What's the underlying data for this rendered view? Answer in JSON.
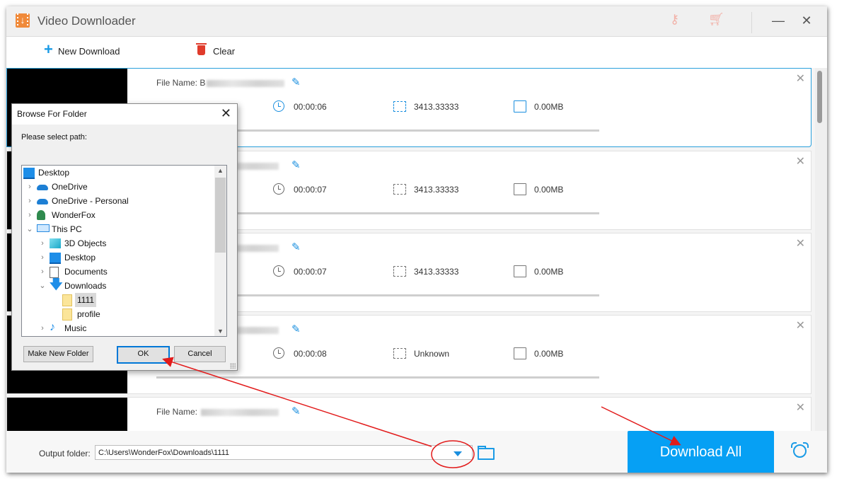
{
  "window": {
    "title": "Video Downloader",
    "title_icons": [
      "key-icon",
      "cart-icon"
    ],
    "minimize_glyph": "—",
    "close_glyph": "✕"
  },
  "toolbar": {
    "new_download_label": "New Download",
    "clear_label": "Clear"
  },
  "downloads": {
    "file_name_label": "File Name:",
    "items": [
      {
        "name_prefix": "B",
        "duration": "00:00:06",
        "resolution": "3413.33333",
        "size": "0.00MB",
        "selected": true
      },
      {
        "name_prefix": "",
        "duration": "00:00:07",
        "resolution": "3413.33333",
        "size": "0.00MB",
        "selected": false
      },
      {
        "name_prefix": "",
        "duration": "00:00:07",
        "resolution": "3413.33333",
        "size": "0.00MB",
        "selected": false
      },
      {
        "name_prefix": "",
        "duration": "00:00:08",
        "resolution": "Unknown",
        "size": "0.00MB",
        "selected": false
      },
      {
        "name_prefix": "",
        "duration": "",
        "resolution": "",
        "size": "",
        "selected": false
      }
    ],
    "item_close_glyph": "✕"
  },
  "footer": {
    "output_folder_label": "Output folder:",
    "output_folder_value": "C:\\Users\\WonderFox\\Downloads\\1111",
    "download_all_label": "Download All"
  },
  "dialog": {
    "title": "Browse For Folder",
    "close_glyph": "✕",
    "prompt": "Please select path:",
    "tree": [
      {
        "label": "Desktop",
        "icon": "desktop",
        "indent": 0,
        "expander": ""
      },
      {
        "label": "OneDrive",
        "icon": "cloud",
        "indent": 1,
        "expander": "›"
      },
      {
        "label": "OneDrive - Personal",
        "icon": "cloud",
        "indent": 1,
        "expander": "›"
      },
      {
        "label": "WonderFox",
        "icon": "user",
        "indent": 1,
        "expander": "›"
      },
      {
        "label": "This PC",
        "icon": "pc",
        "indent": 1,
        "expander": "⌄"
      },
      {
        "label": "3D Objects",
        "icon": "3d",
        "indent": 2,
        "expander": "›"
      },
      {
        "label": "Desktop",
        "icon": "desktop",
        "indent": 2,
        "expander": "›"
      },
      {
        "label": "Documents",
        "icon": "docs",
        "indent": 2,
        "expander": "›"
      },
      {
        "label": "Downloads",
        "icon": "down",
        "indent": 2,
        "expander": "⌄"
      },
      {
        "label": "1111",
        "icon": "folder",
        "indent": 3,
        "expander": "",
        "selected": true
      },
      {
        "label": "profile",
        "icon": "folder",
        "indent": 3,
        "expander": ""
      },
      {
        "label": "Music",
        "icon": "music",
        "indent": 2,
        "expander": "›"
      }
    ],
    "buttons": {
      "make_new_folder": "Make New Folder",
      "ok": "OK",
      "cancel": "Cancel"
    }
  },
  "annotations": {
    "color": "#e21b1b"
  }
}
